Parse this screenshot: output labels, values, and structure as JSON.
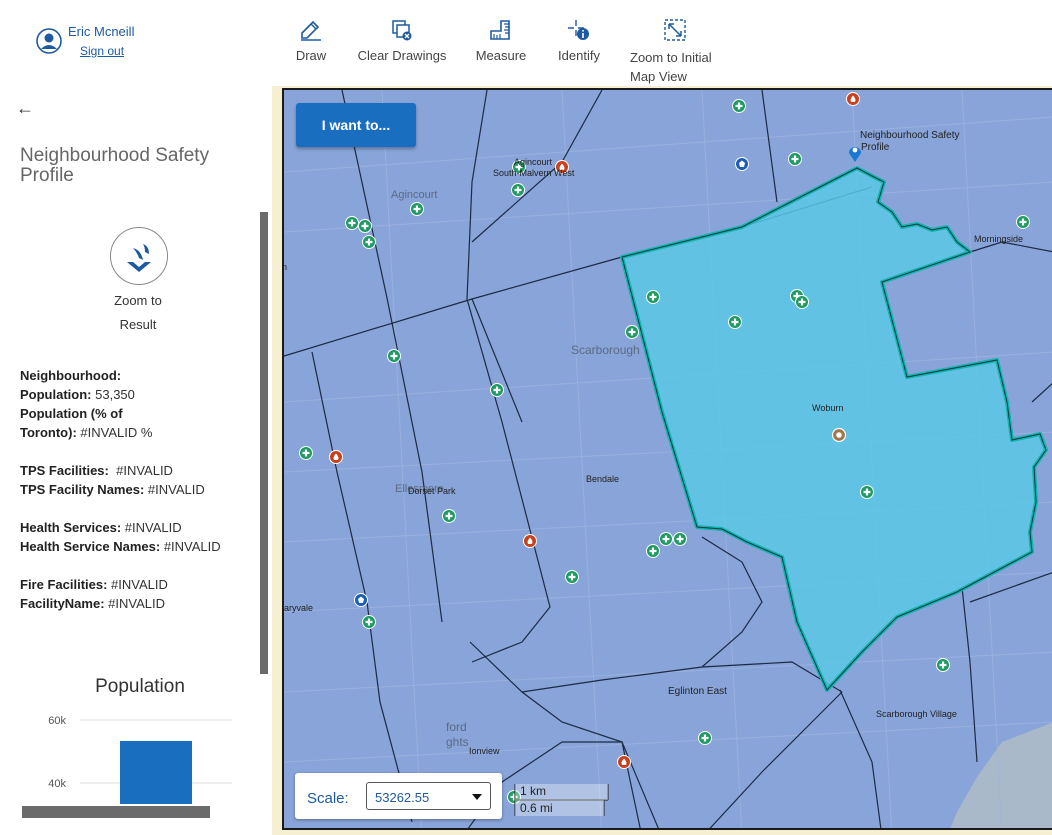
{
  "user": {
    "name": "Eric Mcneill",
    "sign_out": "Sign out"
  },
  "toolbar": [
    {
      "label": "Draw",
      "icon": "draw-icon"
    },
    {
      "label": "Clear Drawings",
      "icon": "clear-drawings-icon"
    },
    {
      "label": "Measure",
      "icon": "measure-icon"
    },
    {
      "label": "Identify",
      "icon": "identify-icon"
    },
    {
      "label": "Zoom to Initial Map View",
      "icon": "zoom-extent-icon"
    }
  ],
  "panel": {
    "back_icon": "back-arrow-icon",
    "title": "Neighbourhood Safety Profile",
    "zoom_label_1": "Zoom to",
    "zoom_label_2": "Result",
    "attributes": {
      "neighbourhood_label": "Neighbourhood:",
      "population_label": "Population:",
      "population_value": "53,350",
      "pct_label_1": "Population (% of",
      "pct_label_2": "Toronto):",
      "pct_value": "#INVALID %",
      "tps_label": "TPS Facilities:",
      "tps_value": "#INVALID",
      "tps_names_label": "TPS Facility Names:",
      "tps_names_value": "#INVALID",
      "health_label": "Health Services:",
      "health_value": "#INVALID",
      "health_names_label": "Health Service Names:",
      "health_names_value": "#INVALID",
      "fire_label": "Fire Facilities:",
      "fire_value": "#INVALID",
      "facility_label": "FacilityName:",
      "facility_value": "#INVALID"
    }
  },
  "chart_data": {
    "type": "bar",
    "title": "Population",
    "categories": [
      ""
    ],
    "values": [
      53350
    ],
    "yticks": [
      "60k",
      "40k"
    ],
    "ylim": [
      40000,
      60000
    ],
    "grid": true,
    "color": "#1a6ec0"
  },
  "map": {
    "i_want_to": "I want to...",
    "scale_label": "Scale:",
    "scale_value": "53262.55",
    "scalebar_km": "1 km",
    "scalebar_mi": "0.6 mi",
    "selected_fill": "#5ac8e6",
    "selected_outline": "#13b3b0",
    "labels": {
      "nsp_marker": "Neighbourhood Safety",
      "nsp_marker_2": "Profile",
      "agincourt_small": "Agincourt",
      "south_malvern": "South-Malvern West",
      "agincourt": "Agincourt",
      "morningside": "Morningside",
      "scarborough": "Scarborough",
      "woburn": "Woburn",
      "bendale": "Bendale",
      "dorset_park": "Dorset Park",
      "ellesmere": "Ellesmere",
      "maryvale": "aryvale",
      "eglinton_east": "Eglinton East",
      "scarborough_village": "Scarborough Village",
      "scarborough_heights_1": "ford",
      "scarborough_heights_2": "ghts",
      "ionview": "Ionview",
      "left_edge": "n"
    }
  }
}
